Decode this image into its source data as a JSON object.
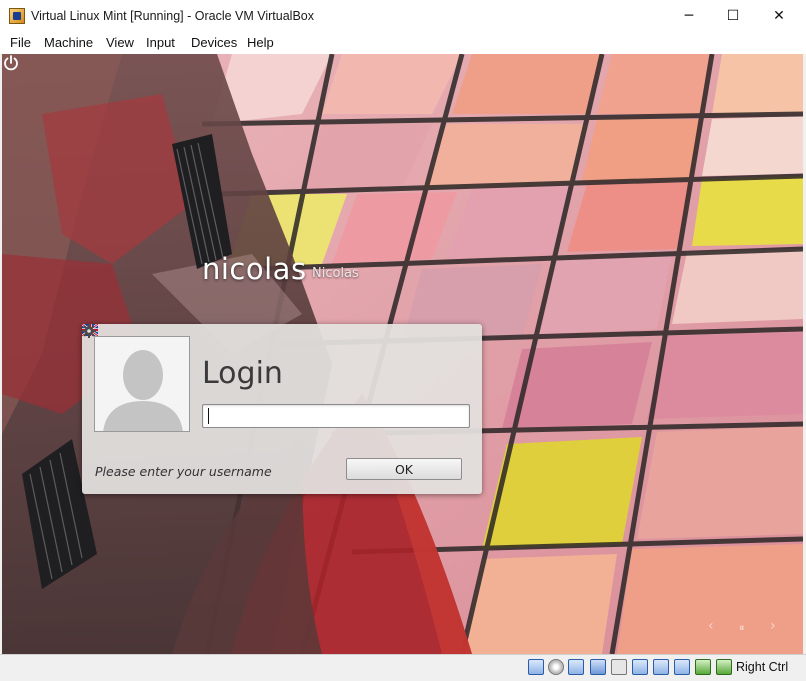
{
  "window": {
    "title": "Virtual Linux Mint [Running] - Oracle VM VirtualBox",
    "app_icon": "virtualbox-icon",
    "controls": {
      "minimize": "─",
      "maximize": "☐",
      "close": "✕"
    }
  },
  "menubar": {
    "items": [
      {
        "label": "File"
      },
      {
        "label": "Machine"
      },
      {
        "label": "View"
      },
      {
        "label": "Input"
      },
      {
        "label": "Devices"
      },
      {
        "label": "Help"
      }
    ]
  },
  "greeter": {
    "user_name": "nicolas",
    "real_name": "Nicolas",
    "login_title": "Login",
    "input_value": "",
    "message": "Please enter your username",
    "ok_label": "OK",
    "icons": [
      "power-icon",
      "uk-flag-icon",
      "gear-icon",
      "avatar-silhouette-icon"
    ],
    "nav": {
      "prev": "‹",
      "pause": "⏸",
      "next": "›"
    }
  },
  "statusbar": {
    "icons": [
      "hard-disk-icon",
      "optical-drive-icon",
      "audio-icon",
      "network-icon",
      "usb-icon",
      "shared-folders-icon",
      "display-icon",
      "video-capture-icon",
      "cpu-icon",
      "mouse-integration-icon",
      "host-key-icon"
    ],
    "host_key_label": "Right Ctrl"
  },
  "colors": {
    "accent": "#2a5ca8",
    "greeter_panel": "#e2e0de",
    "wallpaper_pink": "#e6a1a8",
    "wallpaper_yellow": "#dfcf3c",
    "wallpaper_red": "#a8242a"
  }
}
